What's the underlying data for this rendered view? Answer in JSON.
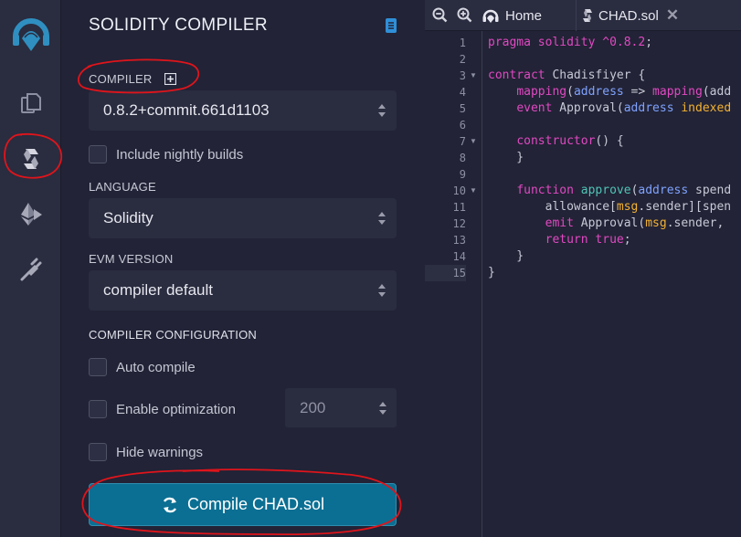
{
  "panel": {
    "title": "SOLIDITY COMPILER",
    "compiler_label": "COMPILER",
    "compiler_version": "0.8.2+commit.661d1103",
    "nightly_label": "Include nightly builds",
    "language_label": "LANGUAGE",
    "language_value": "Solidity",
    "evm_label": "EVM VERSION",
    "evm_value": "compiler default",
    "config_label": "COMPILER CONFIGURATION",
    "auto_compile_label": "Auto compile",
    "optimization_label": "Enable optimization",
    "runs_value": "200",
    "hide_warnings_label": "Hide warnings",
    "compile_button": "Compile CHAD.sol"
  },
  "tabs": {
    "home": "Home",
    "file": "CHAD.sol",
    "close": "✕"
  },
  "code_lines": [
    "pragma solidity ^0.8.2;",
    "",
    "contract Chadisfiyer {",
    "    mapping(address => mapping(add",
    "    event Approval(address indexed",
    "",
    "    constructor() {",
    "    }",
    "",
    "    function approve(address spend",
    "        allowance[msg.sender][spen",
    "        emit Approval(msg.sender, ",
    "        return true;",
    "    }",
    "}"
  ],
  "line_numbers": [
    "1",
    "2",
    "3",
    "4",
    "5",
    "6",
    "7",
    "8",
    "9",
    "10",
    "11",
    "12",
    "13",
    "14",
    "15"
  ],
  "colors": {
    "accent": "#0b6f93",
    "annotation": "#e0141b",
    "rail": "#2a2c3f",
    "panel": "#222336"
  },
  "icons": [
    "remix-logo-icon",
    "file-explorer-icon",
    "solidity-compiler-icon",
    "deploy-run-icon",
    "plugin-manager-icon",
    "documentation-icon",
    "zoom-out-icon",
    "zoom-in-icon",
    "home-icon",
    "solidity-file-icon",
    "refresh-icon"
  ]
}
